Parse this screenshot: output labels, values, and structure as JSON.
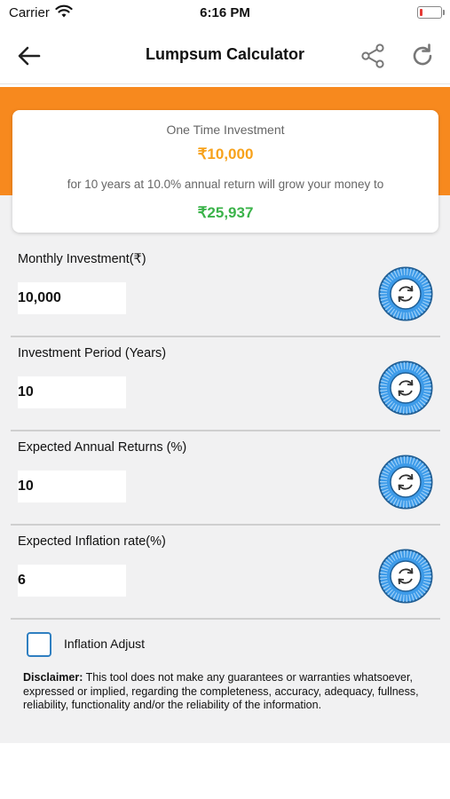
{
  "status_bar": {
    "carrier": "Carrier",
    "time": "6:16 PM"
  },
  "header": {
    "title": "Lumpsum Calculator"
  },
  "result": {
    "label": "One Time Investment",
    "amount": "₹10,000",
    "description": "for 10 years at 10.0% annual return will grow your money to",
    "future_value": "₹25,937"
  },
  "inputs": [
    {
      "label": "Monthly Investment(₹)",
      "value": "10,000"
    },
    {
      "label": "Investment Period (Years)",
      "value": "10"
    },
    {
      "label": "Expected Annual Returns (%)",
      "value": "10"
    },
    {
      "label": "Expected Inflation rate(%)",
      "value": "6"
    }
  ],
  "inflation_adjust": {
    "label": "Inflation Adjust",
    "checked": false
  },
  "disclaimer": {
    "title": "Disclaimer:",
    "text": "This tool does not make any guarantees or warranties whatsoever, expressed or implied, regarding the completeness, accuracy, adequacy, fullness, reliability, functionality and/or the reliability of the information."
  },
  "colors": {
    "accent_orange": "#f7891e",
    "amount_orange": "#f7a21b",
    "result_green": "#3bb34a",
    "reset_blue": "#3d9be9"
  },
  "icons": [
    "back-arrow-icon",
    "share-icon",
    "refresh-icon",
    "reset-dial-icon",
    "checkbox-icon",
    "wifi-icon",
    "battery-icon"
  ]
}
